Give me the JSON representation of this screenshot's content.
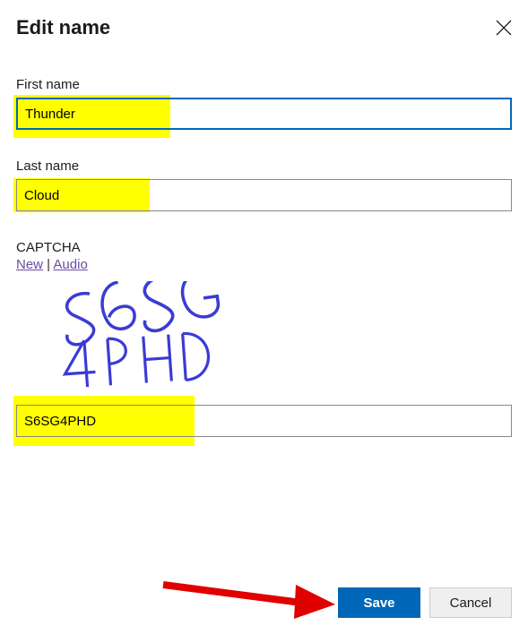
{
  "dialog": {
    "title": "Edit name"
  },
  "fields": {
    "first_name": {
      "label": "First name",
      "value": "Thunder"
    },
    "last_name": {
      "label": "Last name",
      "value": "Cloud"
    }
  },
  "captcha": {
    "label": "CAPTCHA",
    "new_link": "New",
    "separator": " | ",
    "audio_link": "Audio",
    "image_text": "S6SG4PHD",
    "input_value": "S6SG4PHD"
  },
  "buttons": {
    "save": "Save",
    "cancel": "Cancel"
  }
}
